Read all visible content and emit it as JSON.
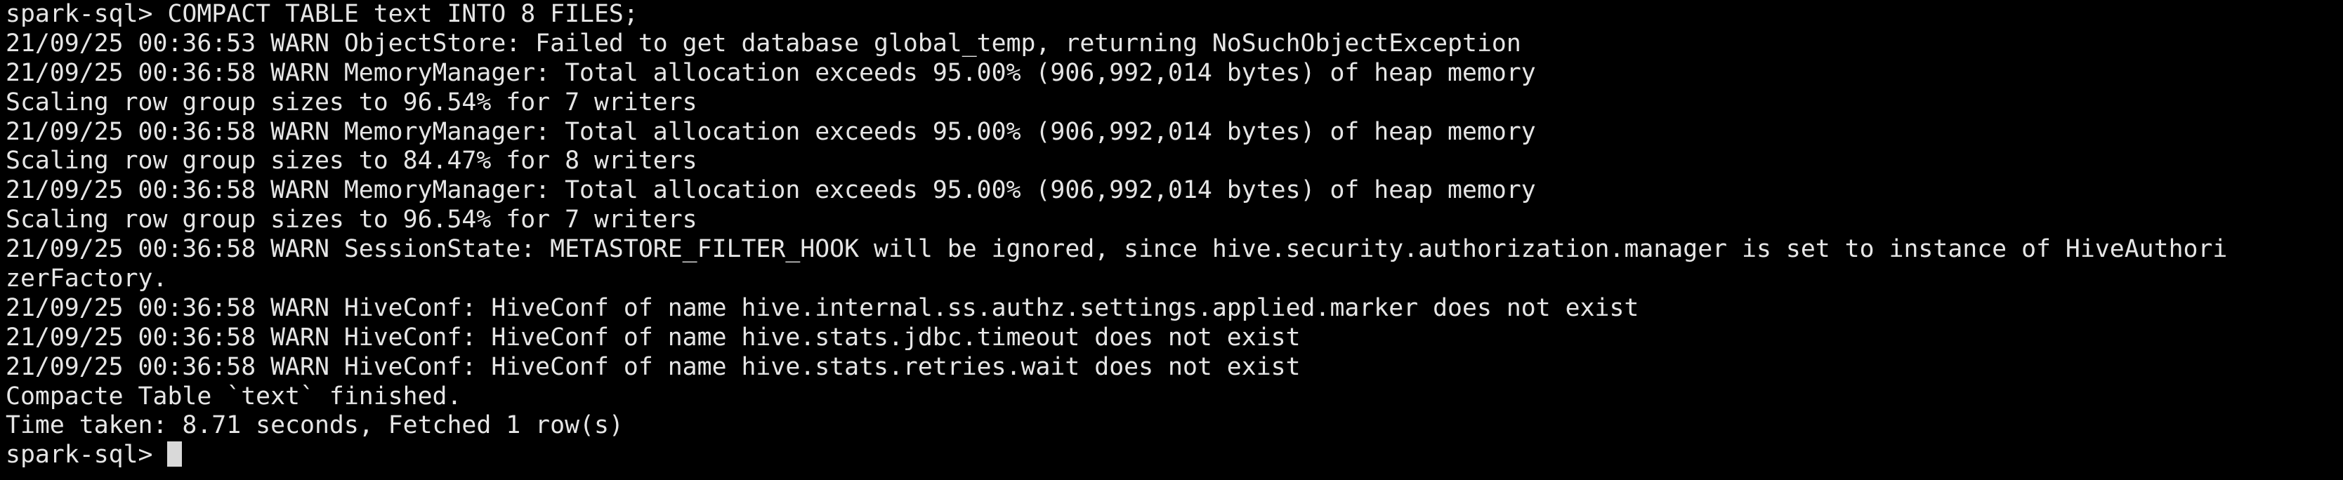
{
  "terminal": {
    "background": "#000000",
    "foreground": "#e6e6e6",
    "lines": [
      "spark-sql> COMPACT TABLE text INTO 8 FILES;",
      "21/09/25 00:36:53 WARN ObjectStore: Failed to get database global_temp, returning NoSuchObjectException",
      "21/09/25 00:36:58 WARN MemoryManager: Total allocation exceeds 95.00% (906,992,014 bytes) of heap memory",
      "Scaling row group sizes to 96.54% for 7 writers",
      "21/09/25 00:36:58 WARN MemoryManager: Total allocation exceeds 95.00% (906,992,014 bytes) of heap memory",
      "Scaling row group sizes to 84.47% for 8 writers",
      "21/09/25 00:36:58 WARN MemoryManager: Total allocation exceeds 95.00% (906,992,014 bytes) of heap memory",
      "Scaling row group sizes to 96.54% for 7 writers",
      "21/09/25 00:36:58 WARN SessionState: METASTORE_FILTER_HOOK will be ignored, since hive.security.authorization.manager is set to instance of HiveAuthori",
      "zerFactory.",
      "21/09/25 00:36:58 WARN HiveConf: HiveConf of name hive.internal.ss.authz.settings.applied.marker does not exist",
      "21/09/25 00:36:58 WARN HiveConf: HiveConf of name hive.stats.jdbc.timeout does not exist",
      "21/09/25 00:36:58 WARN HiveConf: HiveConf of name hive.stats.retries.wait does not exist",
      "Compacte Table `text` finished.",
      "Time taken: 8.71 seconds, Fetched 1 row(s)"
    ],
    "prompt": "spark-sql> "
  }
}
